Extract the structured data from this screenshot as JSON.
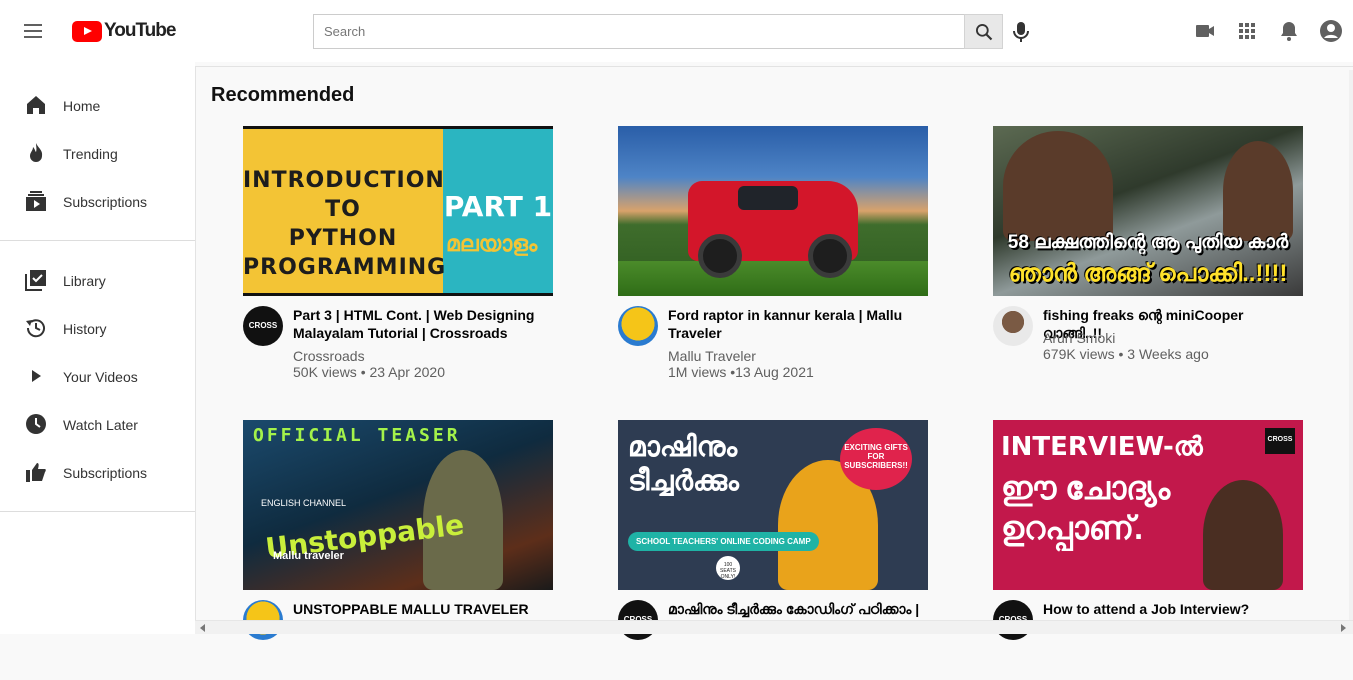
{
  "header": {
    "logo_text": "YouTube",
    "search_placeholder": "Search"
  },
  "sidebar": {
    "items": [
      {
        "label": "Home",
        "icon": "home-icon"
      },
      {
        "label": "Trending",
        "icon": "flame-icon"
      },
      {
        "label": "Subscriptions",
        "icon": "subscriptions-icon"
      },
      {
        "label": "Library",
        "icon": "library-icon"
      },
      {
        "label": "History",
        "icon": "history-icon"
      },
      {
        "label": "Your Videos",
        "icon": "play-icon"
      },
      {
        "label": "Watch Later",
        "icon": "clock-icon"
      },
      {
        "label": "Subscriptions",
        "icon": "thumbs-up-icon"
      }
    ]
  },
  "main": {
    "section_title": "Recommended",
    "videos": [
      {
        "title": "Part 3 | HTML Cont. | Web Designing Malayalam Tutorial | Crossroads",
        "channel": "Crossroads",
        "stats": "50K views • 23 Apr 2020",
        "thumb_line1": "INTRODUCTION TO",
        "thumb_line2": "PYTHON",
        "thumb_line3": "PROGRAMMING",
        "thumb_part": "PART 1",
        "thumb_lang": "മലയാളം",
        "avatar_text": "CROSS"
      },
      {
        "title": "Ford raptor in kannur kerala | Mallu Traveler",
        "channel": "Mallu Traveler",
        "stats": "1M views •13 Aug 2021"
      },
      {
        "title": "fishing freaks ന്റെ miniCooper വാങ്ങി..!!",
        "channel": "Arun Smoki",
        "stats": "679K views • 3 Weeks ago",
        "thumb_line1": "58 ലക്ഷത്തിന്റെ ആ പുതിയ കാർ",
        "thumb_line2": "ഞാൻ അങ്ങ് പൊക്കി..!!!!"
      },
      {
        "title": "UNSTOPPABLE MALLU TRAVELER",
        "thumb_top": "OFFICIAL TEASER",
        "thumb_word": "Unstoppable",
        "thumb_sub": "Mallu traveler",
        "thumb_ch": "ENGLISH CHANNEL"
      },
      {
        "title": "മാഷിനും ടീച്ചർക്കും കോഡിംഗ് പഠിക്കാം |",
        "thumb_line1": "മാഷിനും",
        "thumb_line2": "ടീച്ചർക്കും",
        "thumb_badge": "EXCITING GIFTS FOR SUBSCRIBERS!!",
        "thumb_camp": "SCHOOL TEACHERS' ONLINE CODING CAMP",
        "thumb_seats": "100 SEATS ONLY!",
        "avatar_text": "CROSS"
      },
      {
        "title": "How to attend a Job Interview?",
        "thumb_line1": "INTERVIEW-ൽ",
        "thumb_line2": "ഈ ചോദ്യം",
        "thumb_line3": "ഉറപ്പാണ്.",
        "thumb_logo": "CROSS",
        "avatar_text": "CROSS"
      }
    ]
  },
  "colors": {
    "brand_red": "#ff0000",
    "text_primary": "#030303",
    "text_secondary": "#606060"
  }
}
